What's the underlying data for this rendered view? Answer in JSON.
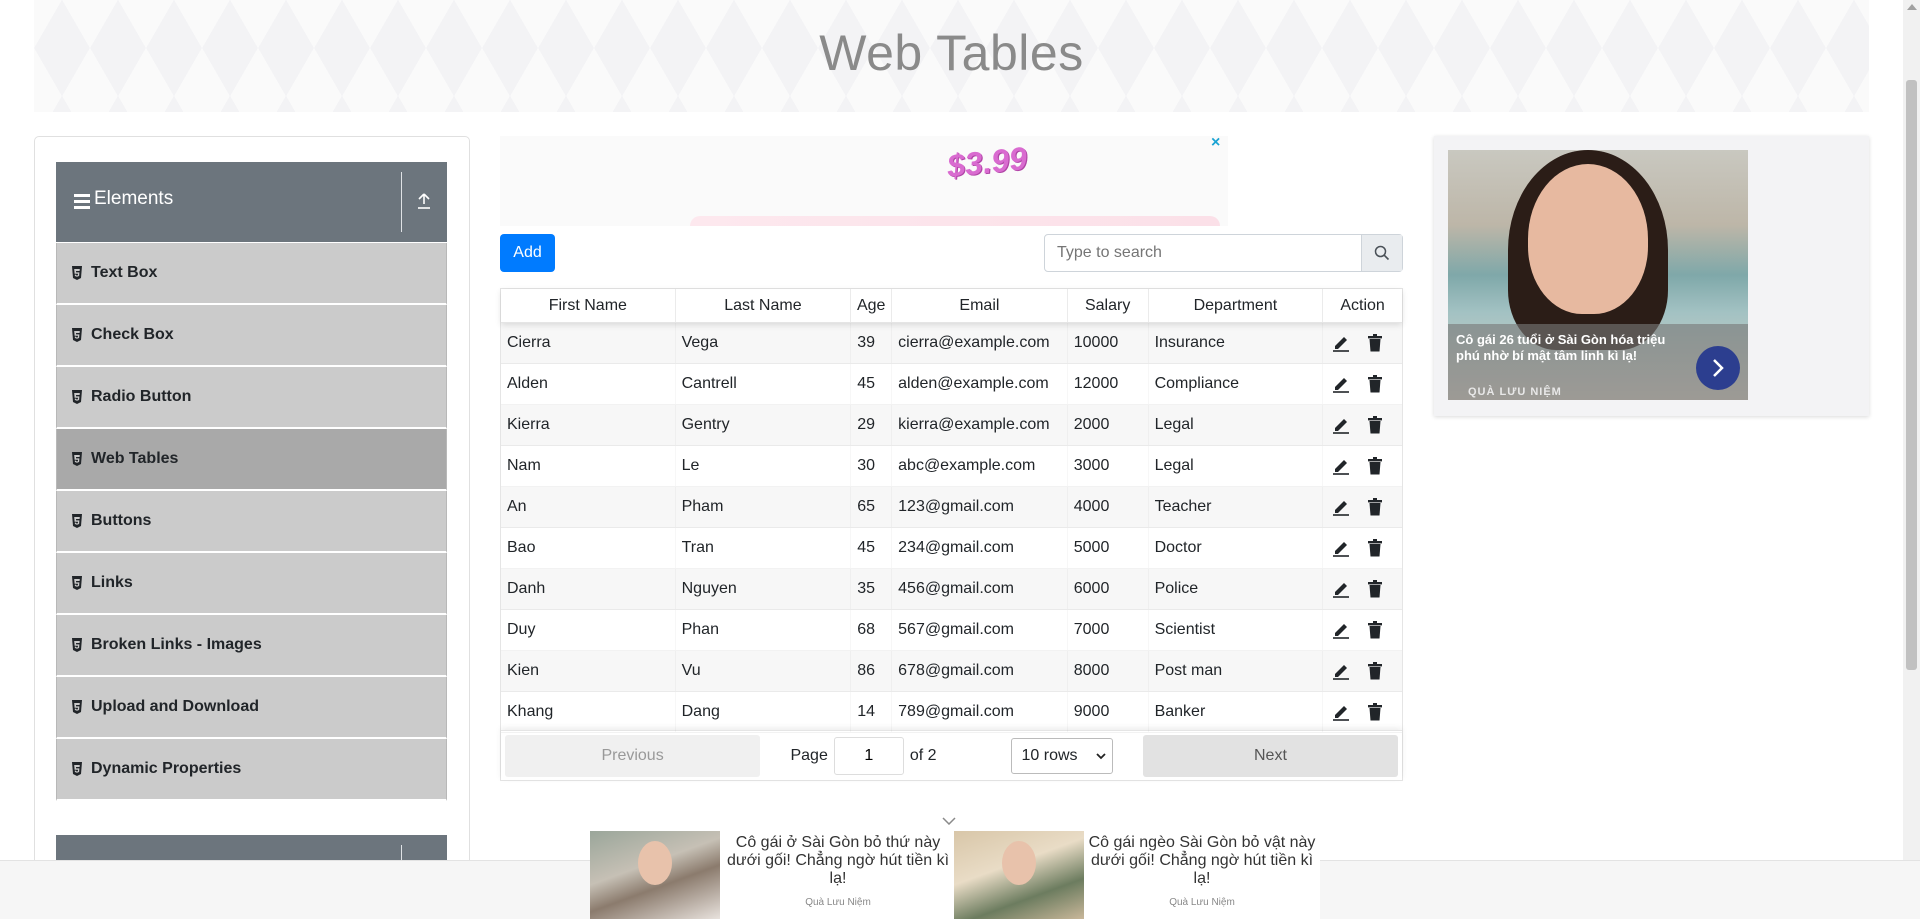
{
  "page": {
    "title": "Web Tables"
  },
  "sidebar": {
    "group_title": "Elements",
    "items": [
      {
        "label": "Text Box",
        "active": false
      },
      {
        "label": "Check Box",
        "active": false
      },
      {
        "label": "Radio Button",
        "active": false
      },
      {
        "label": "Web Tables",
        "active": true
      },
      {
        "label": "Buttons",
        "active": false
      },
      {
        "label": "Links",
        "active": false
      },
      {
        "label": "Broken Links - Images",
        "active": false
      },
      {
        "label": "Upload and Download",
        "active": false
      },
      {
        "label": "Dynamic Properties",
        "active": false
      }
    ]
  },
  "ad_top": {
    "price": "$3.99",
    "close": "×"
  },
  "controls": {
    "add_label": "Add",
    "search_placeholder": "Type to search"
  },
  "table": {
    "headers": [
      "First Name",
      "Last Name",
      "Age",
      "Email",
      "Salary",
      "Department",
      "Action"
    ],
    "rows": [
      [
        "Cierra",
        "Vega",
        "39",
        "cierra@example.com",
        "10000",
        "Insurance"
      ],
      [
        "Alden",
        "Cantrell",
        "45",
        "alden@example.com",
        "12000",
        "Compliance"
      ],
      [
        "Kierra",
        "Gentry",
        "29",
        "kierra@example.com",
        "2000",
        "Legal"
      ],
      [
        "Nam",
        "Le",
        "30",
        "abc@example.com",
        "3000",
        "Legal"
      ],
      [
        "An",
        "Pham",
        "65",
        "123@gmail.com",
        "4000",
        "Teacher"
      ],
      [
        "Bao",
        "Tran",
        "45",
        "234@gmail.com",
        "5000",
        "Doctor"
      ],
      [
        "Danh",
        "Nguyen",
        "35",
        "456@gmail.com",
        "6000",
        "Police"
      ],
      [
        "Duy",
        "Phan",
        "68",
        "567@gmail.com",
        "7000",
        "Scientist"
      ],
      [
        "Kien",
        "Vu",
        "86",
        "678@gmail.com",
        "8000",
        "Post man"
      ],
      [
        "Khang",
        "Dang",
        "14",
        "789@gmail.com",
        "9000",
        "Banker"
      ]
    ]
  },
  "pagination": {
    "previous": "Previous",
    "next": "Next",
    "page_label": "Page",
    "page_value": "1",
    "of_label": "of 2",
    "rows_option": "10 rows"
  },
  "ad_right": {
    "headline": "Cô gái 26 tuổi ở Sài Gòn hóa triệu phú nhờ bí mật tâm linh kì lạ!",
    "source": "QUÀ LƯU NIỆM"
  },
  "bottom_ads": [
    {
      "text": "Cô gái ở Sài Gòn bỏ thứ này dưới gối! Chẳng ngờ hút tiền kì lạ!",
      "source": "Quà Lưu Niệm"
    },
    {
      "text": "Cô gái ngèo Sài Gòn bỏ vật này dưới gối! Chẳng ngờ hút tiền kì lạ!",
      "source": "Quà Lưu Niệm"
    }
  ],
  "colors": {
    "primary": "#007bff",
    "sidebar_header": "#6c757d",
    "menu_item": "#cbcbcb",
    "menu_active": "#a9a9a9"
  }
}
